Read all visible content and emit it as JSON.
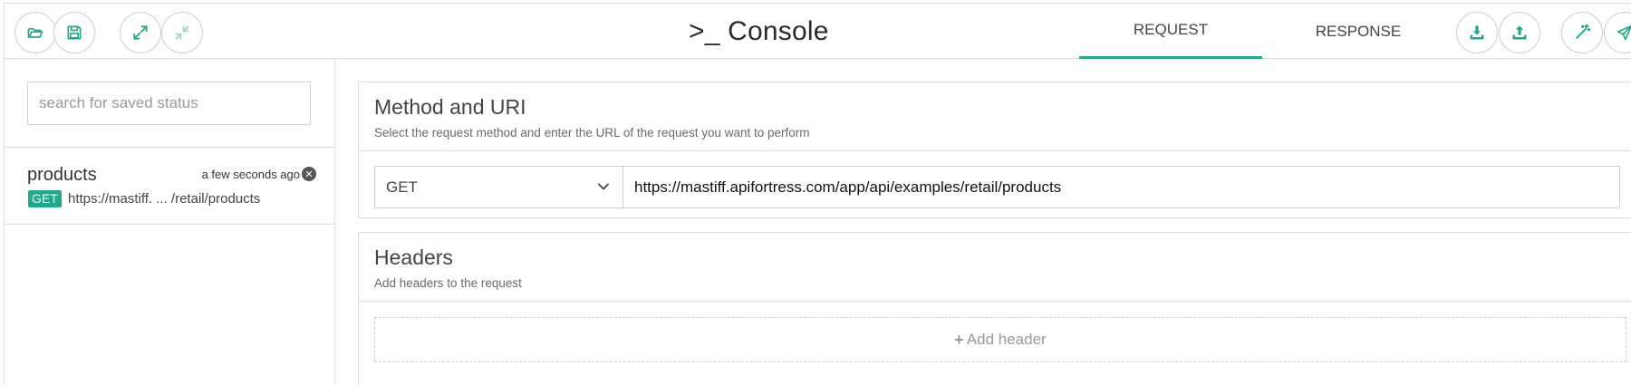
{
  "header": {
    "title": "Console",
    "title_icon": "terminal-prompt-icon"
  },
  "toolbar_left": [
    {
      "name": "open-folder",
      "icon": "folder-open-icon"
    },
    {
      "name": "save",
      "icon": "floppy-disk-icon"
    },
    {
      "name": "expand",
      "icon": "expand-arrows-icon"
    },
    {
      "name": "collapse",
      "icon": "compress-arrows-icon"
    }
  ],
  "tabs": [
    {
      "label": "REQUEST",
      "active": true
    },
    {
      "label": "RESPONSE",
      "active": false
    }
  ],
  "toolbar_right": [
    {
      "name": "download",
      "icon": "download-tray-icon"
    },
    {
      "name": "upload",
      "icon": "upload-tray-icon"
    },
    {
      "name": "magic",
      "icon": "magic-wand-icon"
    },
    {
      "name": "send",
      "icon": "paper-plane-icon"
    }
  ],
  "sidebar": {
    "search_placeholder": "search for saved status",
    "search_value": "",
    "items": [
      {
        "name": "products",
        "time": "a few seconds ago",
        "method": "GET",
        "url": "https://mastiff. ... /retail/products"
      }
    ]
  },
  "method_uri": {
    "title": "Method and URI",
    "subtitle": "Select the request method and enter the URL of the request you want to perform",
    "method": "GET",
    "url": "https://mastiff.apifortress.com/app/api/examples/retail/products"
  },
  "headers": {
    "title": "Headers",
    "subtitle": "Add headers to the request",
    "add_label": "Add header"
  },
  "colors": {
    "accent": "#20a98b",
    "border": "#dcdcdc",
    "muted_text": "#9a9a9a"
  }
}
